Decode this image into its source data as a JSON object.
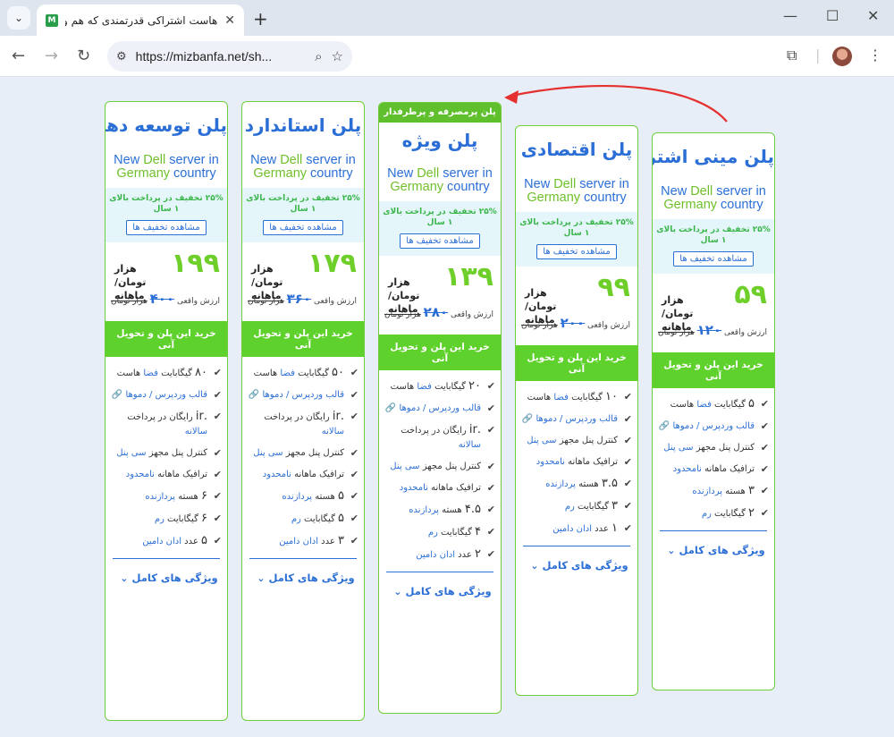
{
  "browser": {
    "tab_title": "هاست اشتراکی قدرتمندی که هم و",
    "favicon_letter": "M",
    "url": "https://mizbanfa.net/sh...",
    "new_tab": "+",
    "tab_close": "✕",
    "tab_menu": "⌄"
  },
  "plans": [
    {
      "name": "پلن توسعه دهنده",
      "ribbon": "",
      "promo": {
        "a": "New ",
        "dell": "Dell",
        "b": " server in ",
        "ger": "Germany",
        "c": " country"
      },
      "discount": "۲۵% تخفیف در پرداخت بالای ۱ سال",
      "discount_btn": "مشاهده تخفیف ها",
      "price": "۱۹۹",
      "unit": "هزار تومان/ ماهانه",
      "real_label": "ارزش واقعی",
      "real_old": "۴۰۰",
      "real_unit": "هزار تومان",
      "buy": "خرید این پلن و تحویل آنی",
      "features": [
        {
          "num": "۸۰",
          "text": "گیگابایت",
          "link": "فضا",
          "rest": "هاست"
        },
        {
          "num": "",
          "text": "",
          "link": "قالب وردپرس / دموها",
          "rest": ""
        },
        {
          "num": ".ir",
          "text": "رایگان در پرداخت",
          "link": "سالانه",
          "rest": ""
        },
        {
          "num": "",
          "text": "کنترل پنل مجهز",
          "link": "سی پنل",
          "rest": ""
        },
        {
          "num": "",
          "text": "ترافیک ماهانه",
          "link": "نامحدود",
          "rest": ""
        },
        {
          "num": "۶",
          "text": "هسته",
          "link": "پردازنده",
          "rest": ""
        },
        {
          "num": "۶",
          "text": "گیگابایت",
          "link": "رم",
          "rest": ""
        },
        {
          "num": "۵",
          "text": "عدد",
          "link": "ادان دامین",
          "rest": ""
        }
      ],
      "full_features": "ویژگی های کامل"
    },
    {
      "name": "پلن استاندارد",
      "ribbon": "",
      "promo": {
        "a": "New ",
        "dell": "Dell",
        "b": " server in ",
        "ger": "Germany",
        "c": " country"
      },
      "discount": "۲۵% تخفیف در پرداخت بالای ۱ سال",
      "discount_btn": "مشاهده تخفیف ها",
      "price": "۱۷۹",
      "unit": "هزار تومان/ ماهانه",
      "real_label": "ارزش واقعی",
      "real_old": "۳۶۰",
      "real_unit": "هزار تومان",
      "buy": "خرید این پلن و تحویل آنی",
      "features": [
        {
          "num": "۵۰",
          "text": "گیگابایت",
          "link": "فضا",
          "rest": "هاست"
        },
        {
          "num": "",
          "text": "",
          "link": "قالب وردپرس / دموها",
          "rest": ""
        },
        {
          "num": ".ir",
          "text": "رایگان در پرداخت",
          "link": "سالانه",
          "rest": ""
        },
        {
          "num": "",
          "text": "کنترل پنل مجهز",
          "link": "سی پنل",
          "rest": ""
        },
        {
          "num": "",
          "text": "ترافیک ماهانه",
          "link": "نامحدود",
          "rest": ""
        },
        {
          "num": "۵",
          "text": "هسته",
          "link": "پردازنده",
          "rest": ""
        },
        {
          "num": "۵",
          "text": "گیگابایت",
          "link": "رم",
          "rest": ""
        },
        {
          "num": "۳",
          "text": "عدد",
          "link": "ادان دامین",
          "rest": ""
        }
      ],
      "full_features": "ویژگی های کامل"
    },
    {
      "name": "پلن ویژه",
      "ribbon": "پلن پرمصرفه و پرطرفدار",
      "promo": {
        "a": "New ",
        "dell": "Dell",
        "b": " server in ",
        "ger": "Germany",
        "c": " country"
      },
      "discount": "۲۵% تخفیف در پرداخت بالای ۱ سال",
      "discount_btn": "مشاهده تخفیف ها",
      "price": "۱۳۹",
      "unit": "هزار تومان/ ماهانه",
      "real_label": "ارزش واقعی",
      "real_old": "۲۸۰",
      "real_unit": "هزار تومان",
      "buy": "خرید این پلن و تحویل آنی",
      "features": [
        {
          "num": "۲۰",
          "text": "گیگابایت",
          "link": "فضا",
          "rest": "هاست"
        },
        {
          "num": "",
          "text": "",
          "link": "قالب وردپرس / دموها",
          "rest": ""
        },
        {
          "num": ".ir",
          "text": "رایگان در پرداخت",
          "link": "سالانه",
          "rest": ""
        },
        {
          "num": "",
          "text": "کنترل پنل مجهز",
          "link": "سی پنل",
          "rest": ""
        },
        {
          "num": "",
          "text": "ترافیک ماهانه",
          "link": "نامحدود",
          "rest": ""
        },
        {
          "num": "۴.۵",
          "text": "هسته",
          "link": "پردازنده",
          "rest": ""
        },
        {
          "num": "۴",
          "text": "گیگابایت",
          "link": "رم",
          "rest": ""
        },
        {
          "num": "۲",
          "text": "عدد",
          "link": "ادان دامین",
          "rest": ""
        }
      ],
      "full_features": "ویژگی های کامل"
    },
    {
      "name": "پلن اقتصادی",
      "ribbon": "",
      "promo": {
        "a": "New ",
        "dell": "Dell",
        "b": " server in ",
        "ger": "Germany",
        "c": " country"
      },
      "discount": "۲۵% تخفیف در پرداخت بالای ۱ سال",
      "discount_btn": "مشاهده تخفیف ها",
      "price": "۹۹",
      "unit": "هزار تومان/ ماهانه",
      "real_label": "ارزش واقعی",
      "real_old": "۲۰۰",
      "real_unit": "هزار تومان",
      "buy": "خرید این پلن و تحویل آنی",
      "features": [
        {
          "num": "۱۰",
          "text": "گیگابایت",
          "link": "فضا",
          "rest": "هاست"
        },
        {
          "num": "",
          "text": "",
          "link": "قالب وردپرس / دموها",
          "rest": ""
        },
        {
          "num": "",
          "text": "کنترل پنل مجهز",
          "link": "سی پنل",
          "rest": ""
        },
        {
          "num": "",
          "text": "ترافیک ماهانه",
          "link": "نامحدود",
          "rest": ""
        },
        {
          "num": "۳.۵",
          "text": "هسته",
          "link": "پردازنده",
          "rest": ""
        },
        {
          "num": "۳",
          "text": "گیگابایت",
          "link": "رم",
          "rest": ""
        },
        {
          "num": "۱",
          "text": "عدد",
          "link": "ادان دامین",
          "rest": ""
        }
      ],
      "full_features": "ویژگی های کامل"
    },
    {
      "name": "پلن مینی اشتراکی",
      "ribbon": "",
      "promo": {
        "a": "New ",
        "dell": "Dell",
        "b": " server in ",
        "ger": "Germany",
        "c": " country"
      },
      "discount": "۲۵% تخفیف در پرداخت بالای ۱ سال",
      "discount_btn": "مشاهده تخفیف ها",
      "price": "۵۹",
      "unit": "هزار تومان/ ماهانه",
      "real_label": "ارزش واقعی",
      "real_old": "۱۲۰",
      "real_unit": "هزار تومان",
      "buy": "خرید این پلن و تحویل آنی",
      "features": [
        {
          "num": "۵",
          "text": "گیگابایت",
          "link": "فضا",
          "rest": "هاست"
        },
        {
          "num": "",
          "text": "",
          "link": "قالب وردپرس / دموها",
          "rest": ""
        },
        {
          "num": "",
          "text": "کنترل پنل مجهز",
          "link": "سی پنل",
          "rest": ""
        },
        {
          "num": "",
          "text": "ترافیک ماهانه",
          "link": "نامحدود",
          "rest": ""
        },
        {
          "num": "۳",
          "text": "هسته",
          "link": "پردازنده",
          "rest": ""
        },
        {
          "num": "۲",
          "text": "گیگابایت",
          "link": "رم",
          "rest": ""
        }
      ],
      "full_features": "ویژگی های کامل"
    }
  ],
  "colors": {
    "accent_green": "#5fd12c",
    "accent_blue": "#2b6fd6",
    "arrow_red": "#e53030"
  }
}
